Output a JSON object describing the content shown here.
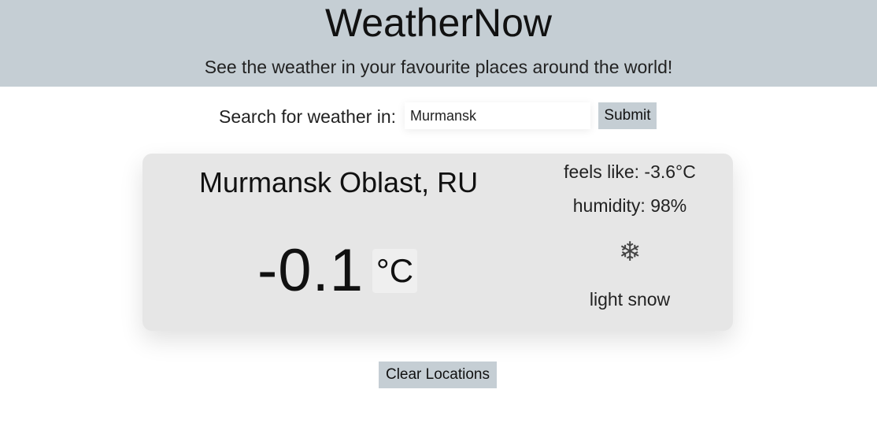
{
  "header": {
    "title": "WeatherNow",
    "tagline": "See the weather in your favourite places around the world!",
    "background_color": "#c5ced4"
  },
  "search": {
    "label": "Search for weather in:",
    "value": "Murmansk",
    "placeholder": "",
    "submit_label": "Submit"
  },
  "card": {
    "location": "Murmansk Oblast, RU",
    "temperature": "-0.1",
    "unit": "°C",
    "feels_like": "feels like: -3.6°C",
    "humidity": "humidity: 98%",
    "icon": "snowflake-icon",
    "icon_glyph": "❄",
    "condition": "light snow"
  },
  "actions": {
    "clear_label": "Clear Locations"
  }
}
